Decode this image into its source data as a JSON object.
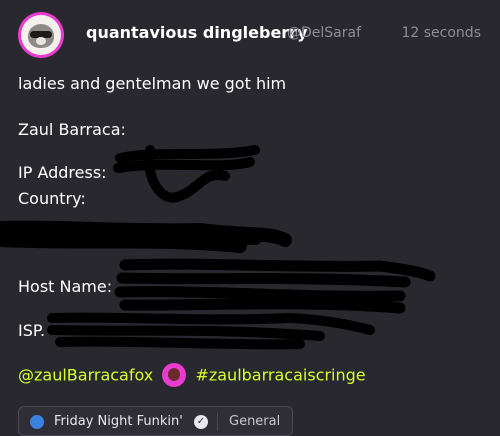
{
  "post": {
    "display_name": "quantavious dingleberry",
    "handle": "@DelSaraf",
    "time": "12 seconds",
    "lines": [
      "ladies and gentelman we got him",
      "Zaul Barraca:",
      "IP Address:",
      "Country:",
      "Host Name:",
      "ISP."
    ],
    "mention": "@zaulBarracafox",
    "hashtag": "#zaulbarracaiscringe",
    "embed": {
      "title": "Friday Night Funkin'",
      "channel": "General"
    }
  },
  "colors": {
    "background": "#29282f",
    "text": "#ffffff",
    "muted": "#8f8d9a",
    "link": "#d7ff2e",
    "avatar_ring": "#e83cd0"
  }
}
